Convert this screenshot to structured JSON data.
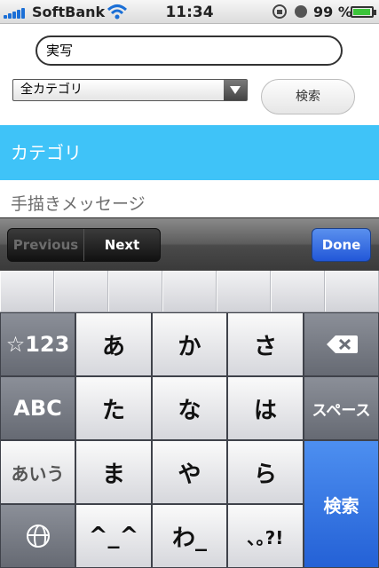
{
  "status_bar": {
    "carrier": "SoftBank",
    "time": "11:34",
    "battery_percent": "99 %",
    "battery_level": 0.99
  },
  "search": {
    "value": "実写"
  },
  "category_select": {
    "selected": "全カテゴリ"
  },
  "search_button_label": "検索",
  "category_header": "カテゴリ",
  "handwritten_label": "手描きメッセージ",
  "toolbar": {
    "previous_label": "Previous",
    "next_label": "Next",
    "done_label": "Done"
  },
  "keyboard": {
    "numbers_key": "☆123",
    "alphabet_key": "ABC",
    "kana_key": "あいう",
    "keys": [
      "あ",
      "か",
      "さ",
      "た",
      "な",
      "は",
      "ま",
      "や",
      "ら",
      "^_^",
      "わ_",
      "､｡?!"
    ],
    "space_key": "スペース",
    "search_key": "検索"
  },
  "colors": {
    "category_band": "#3fc3f8",
    "done_button": "#2c67dd",
    "search_key": "#2f6fe0"
  }
}
